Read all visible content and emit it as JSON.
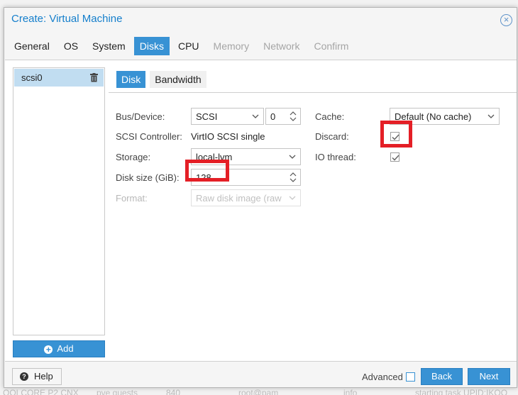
{
  "window": {
    "title": "Create: Virtual Machine"
  },
  "tabs": [
    {
      "label": "General",
      "state": "normal"
    },
    {
      "label": "OS",
      "state": "normal"
    },
    {
      "label": "System",
      "state": "normal"
    },
    {
      "label": "Disks",
      "state": "active"
    },
    {
      "label": "CPU",
      "state": "normal"
    },
    {
      "label": "Memory",
      "state": "disabled"
    },
    {
      "label": "Network",
      "state": "disabled"
    },
    {
      "label": "Confirm",
      "state": "disabled"
    }
  ],
  "disk_list": {
    "items": [
      {
        "label": "scsi0"
      }
    ],
    "add_label": "Add"
  },
  "sub_tabs": [
    {
      "label": "Disk"
    },
    {
      "label": "Bandwidth"
    }
  ],
  "form": {
    "bus_device": {
      "label": "Bus/Device:",
      "bus": "SCSI",
      "device": "0"
    },
    "scsi_controller": {
      "label": "SCSI Controller:",
      "value": "VirtIO SCSI single"
    },
    "storage": {
      "label": "Storage:",
      "value": "local-lvm"
    },
    "disk_size": {
      "label": "Disk size (GiB):",
      "value": "128"
    },
    "format": {
      "label": "Format:",
      "value": "Raw disk image (raw"
    },
    "cache": {
      "label": "Cache:",
      "value": "Default (No cache)"
    },
    "discard": {
      "label": "Discard:",
      "checked": true
    },
    "io_thread": {
      "label": "IO thread:",
      "checked": true
    }
  },
  "footer": {
    "help_label": "Help",
    "advanced_label": "Advanced",
    "back_label": "Back",
    "next_label": "Next"
  },
  "background_row": [
    "OOLCORE P2 CNX",
    "pve guests",
    "840",
    "root@pam",
    "info",
    "starting task UPID:IKOO"
  ],
  "colors": {
    "accent": "#3892d4",
    "title": "#157fcc",
    "highlight": "#e41f26",
    "selection": "#c1ddf1"
  }
}
